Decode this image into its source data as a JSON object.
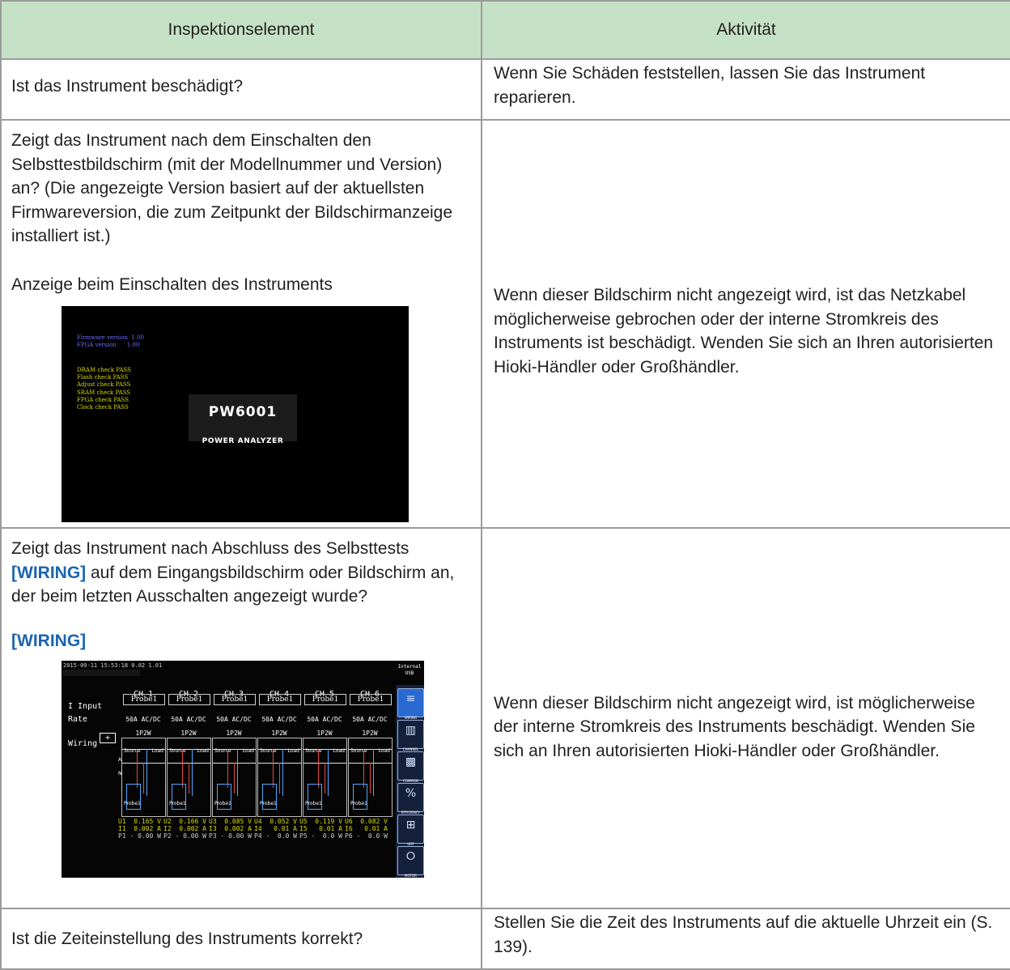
{
  "headers": {
    "item": "Inspektionselement",
    "activity": "Aktivität"
  },
  "rows": [
    {
      "item": "Ist das Instrument beschädigt?",
      "activity": "Wenn Sie Schäden feststellen, lassen Sie das Instrument reparieren."
    },
    {
      "item": "Zeigt das Instrument nach dem Einschalten den Selbsttestbildschirm (mit der Modellnummer und Version) an? (Die angezeigte Version basiert auf der aktuellsten Firmwareversion, die zum Zeitpunkt der Bildschirmanzeige installiert ist.)",
      "caption": "Anzeige beim Einschalten des Instruments",
      "activity": "Wenn dieser Bildschirm nicht angezeigt wird, ist das Netzkabel möglicherweise gebrochen oder der interne Stromkreis des Instruments ist beschädigt. Wenden Sie sich an Ihren autorisierten Hioki-Händler oder Großhändler."
    },
    {
      "item_pre": "Zeigt das Instrument nach Abschluss des Selbsttests ",
      "item_key": "[WIRING]",
      "item_post": " auf dem Eingangsbildschirm oder Bildschirm an, der beim letzten Ausschalten angezeigt wurde?",
      "caption": "[WIRING]",
      "activity": "Wenn dieser Bildschirm nicht angezeigt wird, ist möglicherweise der interne Stromkreis des Instruments beschädigt. Wenden Sie sich an Ihren autorisierten Hioki-Händler oder Großhändler."
    },
    {
      "item": "Ist die Zeiteinstellung des Instruments korrekt?",
      "activity": "Stellen Sie die Zeit des Instruments auf die aktuelle Uhrzeit ein (S. 139)."
    }
  ],
  "boot_screen": {
    "version_lines": [
      "Firmware version  1.00",
      "FPGA version      1.00"
    ],
    "check_lines": [
      "DRAM check PASS",
      "Flash check PASS",
      "Adjust check PASS",
      "SRAM check PASS",
      "FPGA check PASS",
      "Clock check PASS"
    ],
    "model": "PW6001",
    "subtitle": "POWER ANALYZER"
  },
  "wiring_screen": {
    "datetime": "2015-09-11 15:53:18 0.02 1.01",
    "indicator": [
      "Internal",
      "USB"
    ],
    "labels": {
      "input": "I Input",
      "rate": "Rate",
      "wiring": "Wiring",
      "plus": "+"
    },
    "channels": [
      {
        "name": "CH 1",
        "probe": "Probe1",
        "rate": "50A AC/DC",
        "wiring": "1P2W",
        "u": "U1  0.165 V",
        "i": "I1  0.002 A",
        "p": "P1 - 0.00 W"
      },
      {
        "name": "CH 2",
        "probe": "Probe1",
        "rate": "50A AC/DC",
        "wiring": "1P2W",
        "u": "U2  0.166 V",
        "i": "I2  0.002 A",
        "p": "P2 - 0.00 W"
      },
      {
        "name": "CH 3",
        "probe": "Probe1",
        "rate": "50A AC/DC",
        "wiring": "1P2W",
        "u": "U3  0.085 V",
        "i": "I3  0.002 A",
        "p": "P3 - 0.00 W"
      },
      {
        "name": "CH 4",
        "probe": "Probe1",
        "rate": "50A AC/DC",
        "wiring": "1P2W",
        "u": "U4  0.052 V",
        "i": "I4   0.01 A",
        "p": "P4 -  0.0 W"
      },
      {
        "name": "CH 5",
        "probe": "Probe1",
        "rate": "50A AC/DC",
        "wiring": "1P2W",
        "u": "U5  0.119 V",
        "i": "I5   0.01 A",
        "p": "P5 -  0.0 W"
      },
      {
        "name": "CH 6",
        "probe": "Probe1",
        "rate": "50A AC/DC",
        "wiring": "1P2W",
        "u": "U6  0.082 V",
        "i": "I6   0.01 A",
        "p": "P6 -  0.0 W"
      }
    ],
    "diagram": {
      "source": "Source",
      "load": "Load",
      "probe": "Probe1",
      "a": "A",
      "n": "N"
    },
    "menu": [
      {
        "label": "WIRING",
        "icon": "wiring-icon"
      },
      {
        "label": "CHANNEL",
        "icon": "channel-icon"
      },
      {
        "label": "COMMON",
        "icon": "common-icon"
      },
      {
        "label": "EFFICIENCY",
        "icon": "efficiency-icon"
      },
      {
        "label": "UDF",
        "icon": "udf-icon"
      },
      {
        "label": "MOTOR",
        "icon": "motor-icon"
      }
    ]
  }
}
